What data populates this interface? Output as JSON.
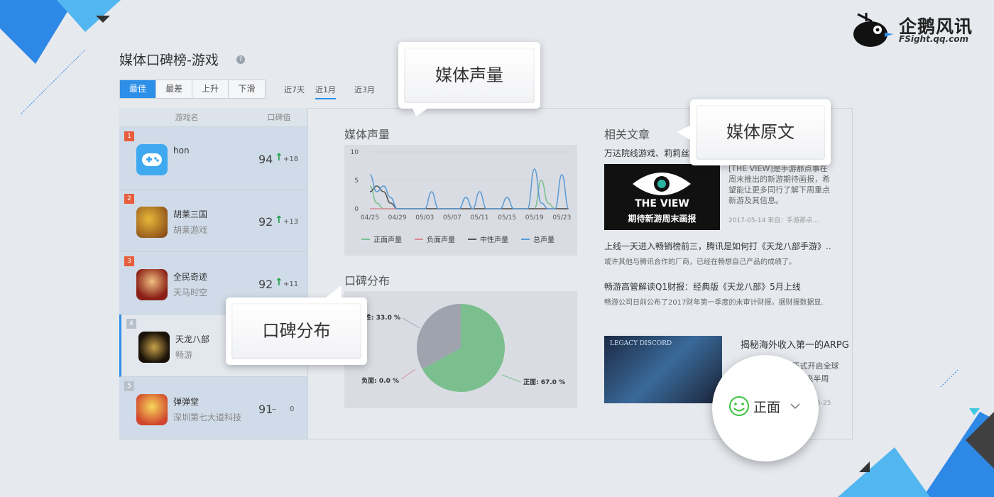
{
  "logo": {
    "text": "企鹅风讯",
    "sub": "FSight.qq.com"
  },
  "page_title": "媒体口碑榜-游戏",
  "filters": [
    "最佳",
    "最差",
    "上升",
    "下滑"
  ],
  "periods": [
    "近7天",
    "近1月",
    "近3月"
  ],
  "list_header": {
    "name": "游戏名",
    "score": "口碑值"
  },
  "games": [
    {
      "rank": "1",
      "name": "hon",
      "publisher": "",
      "score": "94",
      "delta": "+18",
      "arrow": "↑"
    },
    {
      "rank": "2",
      "name": "胡莱三国",
      "publisher": "胡莱游戏",
      "score": "92",
      "delta": "+13",
      "arrow": "↑"
    },
    {
      "rank": "3",
      "name": "全民奇迹",
      "publisher": "天马时空",
      "score": "92",
      "delta": "+11",
      "arrow": "↑"
    },
    {
      "rank": "4",
      "name": "天龙八部",
      "publisher": "畅游",
      "score": "",
      "delta": "",
      "arrow": ""
    },
    {
      "rank": "5",
      "name": "弹弹堂",
      "publisher": "深圳第七大道科技",
      "score": "91",
      "delta": "0",
      "arrow": "–"
    }
  ],
  "media_volume": {
    "title": "媒体声量",
    "legend": [
      "正面声量",
      "负面声量",
      "中性声量",
      "总声量"
    ]
  },
  "sentiment": {
    "title": "口碑分布"
  },
  "articles": {
    "title": "相关文章",
    "a1_title": "万达院线游戏、莉莉丝",
    "a1_body": "[THE VIEW]是手游那点事在周末推出的新游期待画报，希望能让更多同行了解下周重点新游及其信息。",
    "a1_meta": "2017-05-14   来自：手游那点…",
    "a1_img_title": "THE VIEW",
    "a1_img_sub": "期待新游周末画报",
    "a2_title": "上线一天进入畅销榜前三，腾讯是如何打《天龙八部手游》..",
    "a2_body": "或许其他与腾讯合作的厂商，已经在畅想自己产品的成绩了。",
    "a3_title": "畅游高管解读Q1财报：经典版《天龙八部》5月上线",
    "a3_body": "畅游公司日前公布了2017财年第一季度的未审计财报。据财报数据显.",
    "a4_title": "揭秘海外收入第一的ARPG",
    "a4_body1": "于去年11月 日正式开启全球",
    "a4_body2": "之翼》，简称  ），迎来半周",
    "a4_meta": "5-25"
  },
  "callouts": {
    "volume": "媒体声量",
    "source": "媒体原文",
    "distribution": "口碑分布"
  },
  "sentiment_selector": {
    "label": "正面"
  },
  "colors": {
    "accent": "#2d8fe8",
    "positive": "#7bbf8e",
    "negative": "#d98b97",
    "neutral": "#555555",
    "total": "#5b9bd5"
  },
  "chart_data": [
    {
      "type": "line",
      "title": "媒体声量",
      "x": [
        "04/25",
        "04/26",
        "04/27",
        "04/28",
        "04/29",
        "04/30",
        "05/01",
        "05/02",
        "05/03",
        "05/04",
        "05/05",
        "05/06",
        "05/07",
        "05/08",
        "05/09",
        "05/10",
        "05/11",
        "05/12",
        "05/13",
        "05/14",
        "05/15",
        "05/16",
        "05/17",
        "05/18",
        "05/19",
        "05/20",
        "05/21",
        "05/22",
        "05/23",
        "05/24"
      ],
      "xticks": [
        "04/25",
        "04/29",
        "05/03",
        "05/07",
        "05/11",
        "05/15",
        "05/19",
        "05/23"
      ],
      "ylim": [
        0,
        10
      ],
      "yticks": [
        0,
        5,
        10
      ],
      "series": [
        {
          "name": "正面声量",
          "values": [
            4,
            1,
            0,
            0,
            0,
            0,
            0,
            0,
            0,
            0,
            0,
            0,
            0,
            0,
            0,
            0,
            0,
            0,
            0,
            0,
            0,
            0,
            0,
            0,
            0,
            5,
            1,
            0,
            0,
            0
          ]
        },
        {
          "name": "负面声量",
          "values": [
            0,
            0,
            0,
            0,
            0,
            0,
            0,
            0,
            0,
            0,
            0,
            0,
            0,
            0,
            0,
            0,
            0,
            0,
            0,
            0,
            0,
            0,
            0,
            0,
            0,
            0,
            0,
            0,
            0,
            0
          ]
        },
        {
          "name": "中性声量",
          "values": [
            3,
            4,
            3,
            1,
            0,
            0,
            0,
            0,
            0,
            0,
            0,
            0,
            0,
            0,
            0,
            0,
            0,
            0,
            0,
            0,
            0,
            0,
            0,
            0,
            0,
            0,
            0,
            0,
            0,
            0
          ]
        },
        {
          "name": "总声量",
          "values": [
            6,
            3,
            4,
            2,
            0,
            0,
            0,
            0,
            0,
            3,
            0,
            0,
            0,
            0,
            2,
            0,
            3,
            0,
            0,
            0,
            2,
            0,
            0,
            0,
            7,
            1,
            0,
            0,
            6,
            0
          ]
        }
      ]
    },
    {
      "type": "pie",
      "title": "口碑分布",
      "slices": [
        {
          "name": "正面",
          "value": 67.0,
          "label": "正面: 67.0 %"
        },
        {
          "name": "负面",
          "value": 0.0,
          "label": "负面: 0.0 %"
        },
        {
          "name": "中性",
          "value": 33.0,
          "label": "性: 33.0 %"
        }
      ],
      "slice_colors": [
        "#7bbf8e",
        "#d98b97",
        "#9ea3ad"
      ]
    }
  ]
}
